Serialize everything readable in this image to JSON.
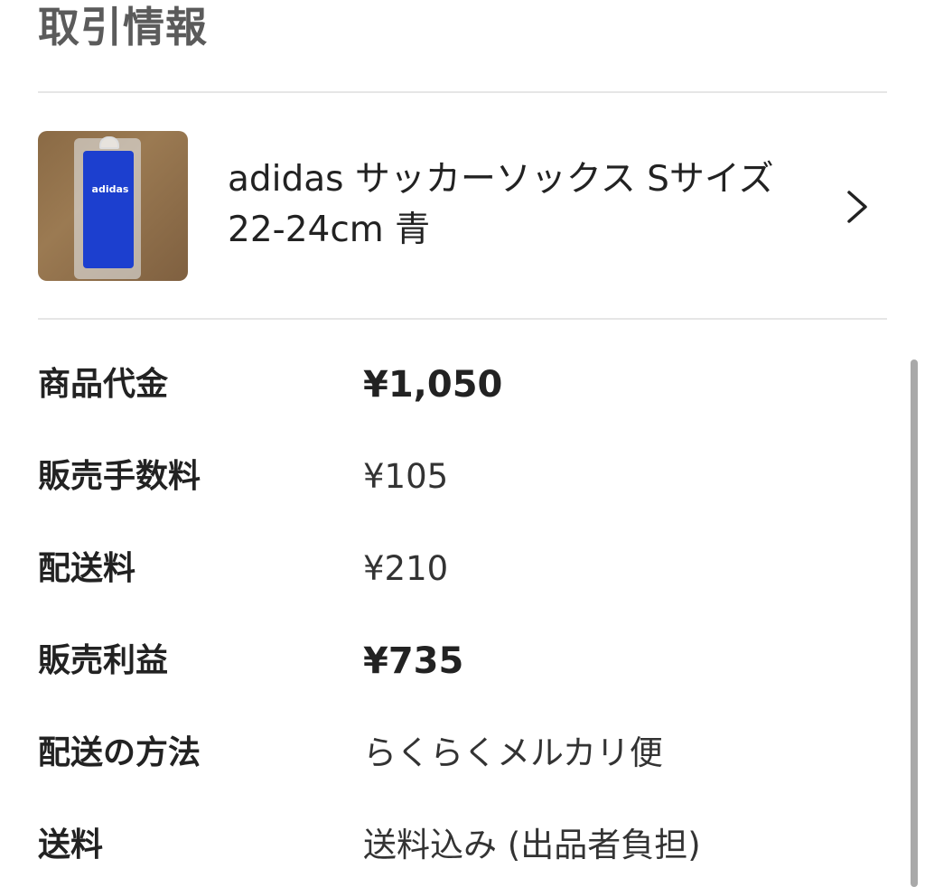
{
  "section": {
    "title": "取引情報"
  },
  "item": {
    "title": "adidas サッカーソックス Sサイズ　22-24cm 青",
    "image_icon": "product-thumbnail",
    "logo_text": "adidas",
    "chevron_icon": "chevron-right-icon"
  },
  "details": [
    {
      "label": "商品代金",
      "value": "¥1,050"
    },
    {
      "label": "販売手数料",
      "value": "¥105"
    },
    {
      "label": "配送料",
      "value": "¥210"
    },
    {
      "label": "販売利益",
      "value": "¥735"
    },
    {
      "label": "配送の方法",
      "value": "らくらくメルカリ便"
    },
    {
      "label": "送料",
      "value": "送料込み (出品者負担)"
    }
  ],
  "colors": {
    "title_gray": "#5b5b5b",
    "divider": "#e6e6e6",
    "sock_blue": "#1c3fcf"
  }
}
